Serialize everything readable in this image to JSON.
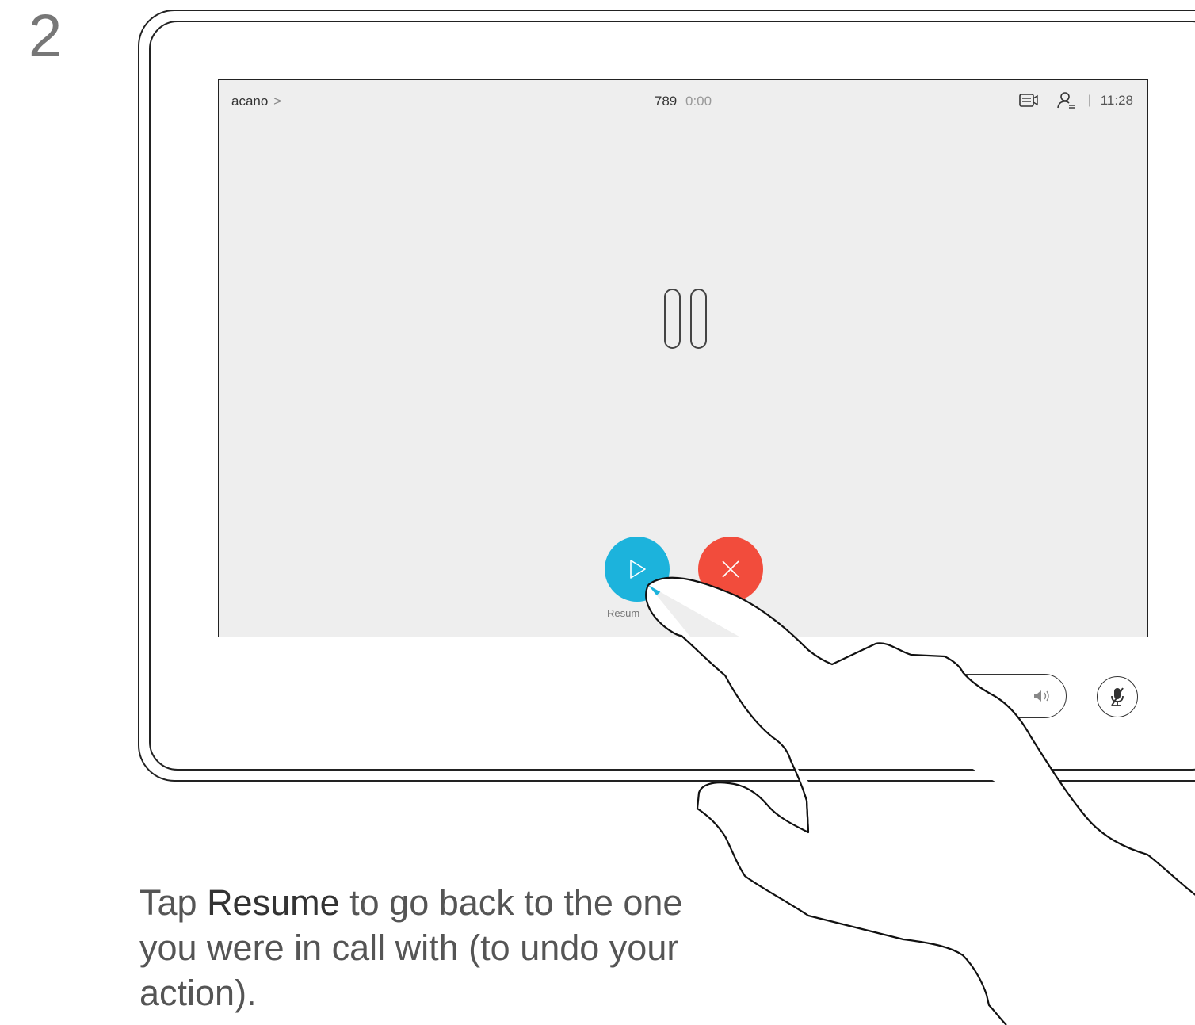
{
  "step": {
    "number": "2"
  },
  "screen": {
    "caller": "acano",
    "caller_chevron": ">",
    "call_number": "789",
    "call_duration": "0:00",
    "clock": "11:28",
    "separator": "|",
    "icons": [
      "layout-icon",
      "participants-icon",
      "pause-icon",
      "play-icon",
      "end-call-icon",
      "volume-icon",
      "mute-mic-icon"
    ]
  },
  "buttons": {
    "resume_label": "Resum"
  },
  "caption": {
    "before": "Tap ",
    "bold": "Resume",
    "after": " to go back to the one you were in call with (to undo your action)."
  },
  "colors": {
    "resume": "#1cb3dc",
    "end_call": "#f24c3c",
    "screen_bg": "#eeeeee"
  }
}
